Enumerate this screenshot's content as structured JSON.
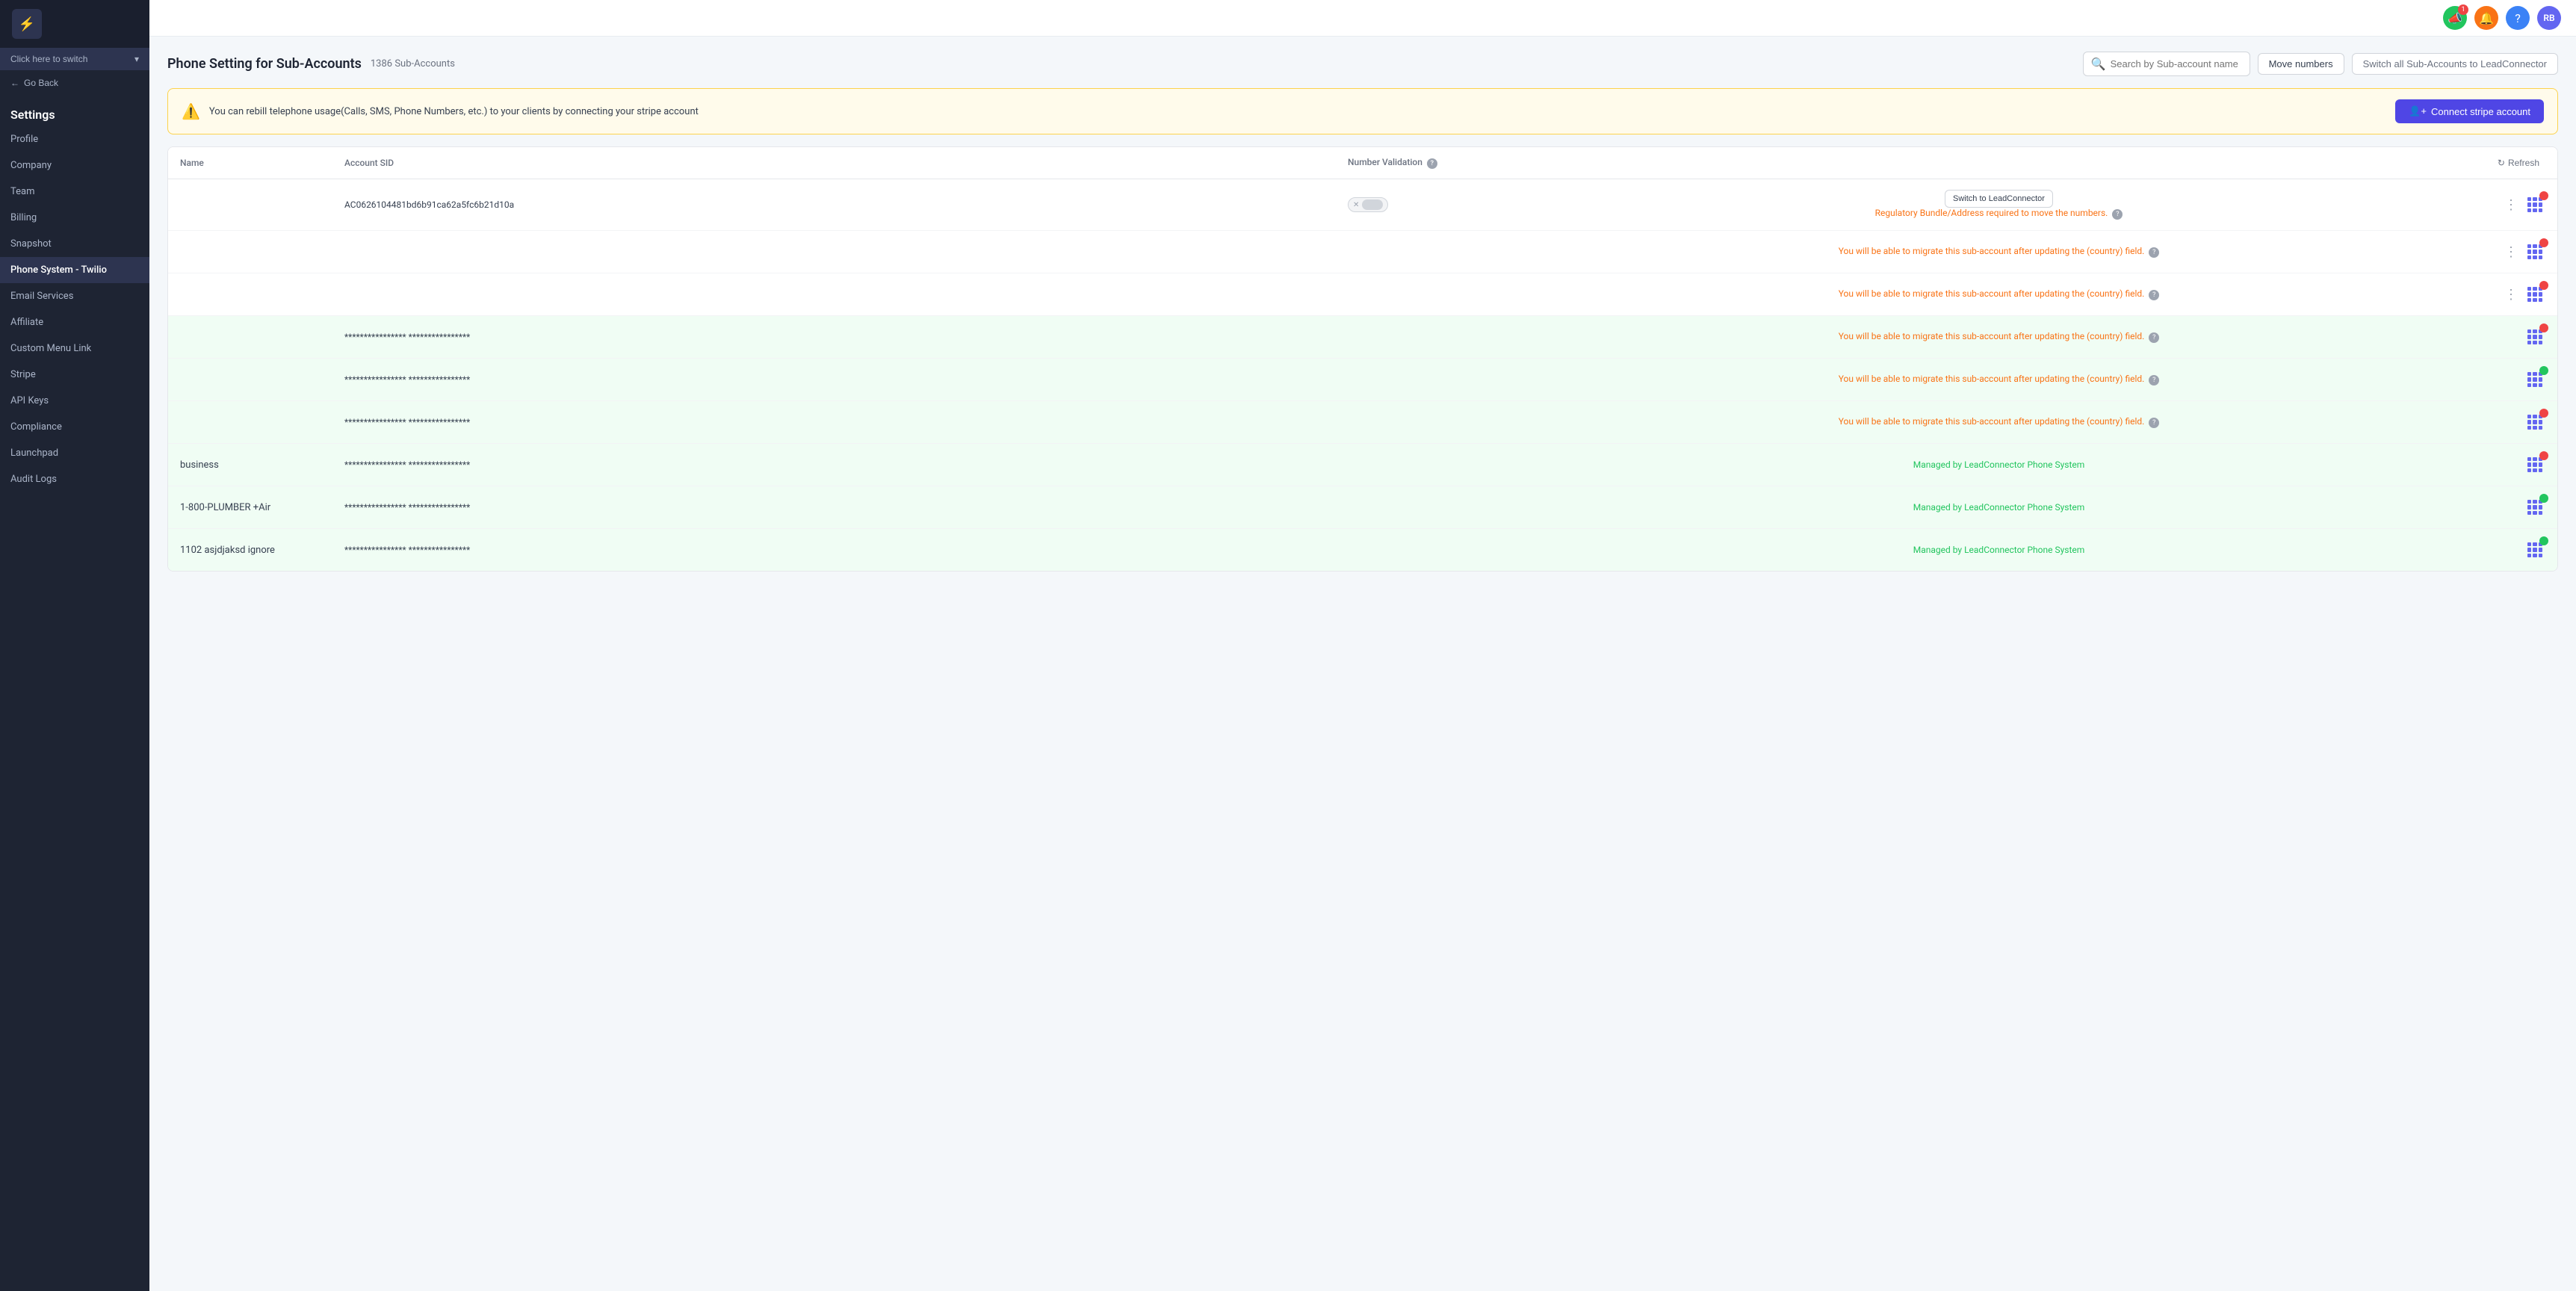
{
  "sidebar": {
    "logo_char": "⚡",
    "switch_label": "Click here to switch",
    "go_back": "Go Back",
    "section_title": "Settings",
    "items": [
      {
        "id": "profile",
        "label": "Profile",
        "active": false
      },
      {
        "id": "company",
        "label": "Company",
        "active": false
      },
      {
        "id": "team",
        "label": "Team",
        "active": false
      },
      {
        "id": "billing",
        "label": "Billing",
        "active": false
      },
      {
        "id": "snapshot",
        "label": "Snapshot",
        "active": false
      },
      {
        "id": "phone-system",
        "label": "Phone System - Twilio",
        "active": true
      },
      {
        "id": "email-services",
        "label": "Email Services",
        "active": false
      },
      {
        "id": "affiliate",
        "label": "Affiliate",
        "active": false
      },
      {
        "id": "custom-menu",
        "label": "Custom Menu Link",
        "active": false
      },
      {
        "id": "stripe",
        "label": "Stripe",
        "active": false
      },
      {
        "id": "api-keys",
        "label": "API Keys",
        "active": false
      },
      {
        "id": "compliance",
        "label": "Compliance",
        "active": false
      },
      {
        "id": "launchpad",
        "label": "Launchpad",
        "active": false
      },
      {
        "id": "audit-logs",
        "label": "Audit Logs",
        "active": false
      }
    ]
  },
  "topbar": {
    "megaphone_badge": "1",
    "avatar_initials": "RB"
  },
  "page": {
    "title": "Phone Setting for Sub-Accounts",
    "sub_count": "1386 Sub-Accounts",
    "search_placeholder": "Search by Sub-account name",
    "move_numbers_btn": "Move numbers",
    "switch_all_btn": "Switch all Sub-Accounts to LeadConnector",
    "alert_text": "You can rebill telephone usage(Calls, SMS, Phone Numbers, etc.) to your clients by connecting your stripe account",
    "connect_btn": "Connect stripe account",
    "refresh_btn": "Refresh",
    "table": {
      "headers": [
        "Name",
        "Account SID",
        "Number Validation",
        "",
        ""
      ],
      "rows": [
        {
          "name": "",
          "account_sid": "AC0626104481bd6b91ca62a5fc6b21d10a",
          "has_toggle": true,
          "switch_label": "Switch to LeadConnector",
          "status": "Regulatory Bundle/Address required to move the numbers.",
          "status_type": "orange",
          "highlight": false,
          "badge_type": "red"
        },
        {
          "name": "",
          "account_sid": "",
          "has_toggle": false,
          "switch_label": "",
          "status": "You will be able to migrate this sub-account after updating the (country) field.",
          "status_type": "orange",
          "highlight": false,
          "badge_type": "red"
        },
        {
          "name": "",
          "account_sid": "",
          "has_toggle": false,
          "switch_label": "",
          "status": "You will be able to migrate this sub-account after updating the (country) field.",
          "status_type": "orange",
          "highlight": false,
          "badge_type": "red"
        },
        {
          "name": "",
          "account_sid": "**************** ****************",
          "has_toggle": false,
          "switch_label": "",
          "status": "You will be able to migrate this sub-account after updating the (country) field.",
          "status_type": "orange",
          "highlight": true,
          "badge_type": "red"
        },
        {
          "name": "",
          "account_sid": "**************** ****************",
          "has_toggle": false,
          "switch_label": "",
          "status": "You will be able to migrate this sub-account after updating the (country) field.",
          "status_type": "orange",
          "highlight": true,
          "badge_type": "green"
        },
        {
          "name": "",
          "account_sid": "**************** ****************",
          "has_toggle": false,
          "switch_label": "",
          "status": "You will be able to migrate this sub-account after updating the (country) field.",
          "status_type": "orange",
          "highlight": true,
          "badge_type": "red"
        },
        {
          "name": "business",
          "account_sid": "**************** ****************",
          "has_toggle": false,
          "switch_label": "",
          "status": "Managed by LeadConnector Phone System",
          "status_type": "green",
          "highlight": true,
          "badge_type": "red"
        },
        {
          "name": "1-800-PLUMBER +Air",
          "account_sid": "**************** ****************",
          "has_toggle": false,
          "switch_label": "",
          "status": "Managed by LeadConnector Phone System",
          "status_type": "green",
          "highlight": true,
          "badge_type": "green"
        },
        {
          "name": "1102 asjdjaksd ignore",
          "account_sid": "**************** ****************",
          "has_toggle": false,
          "switch_label": "",
          "status": "Managed by LeadConnector Phone System",
          "status_type": "green",
          "highlight": true,
          "badge_type": "green"
        }
      ]
    }
  }
}
